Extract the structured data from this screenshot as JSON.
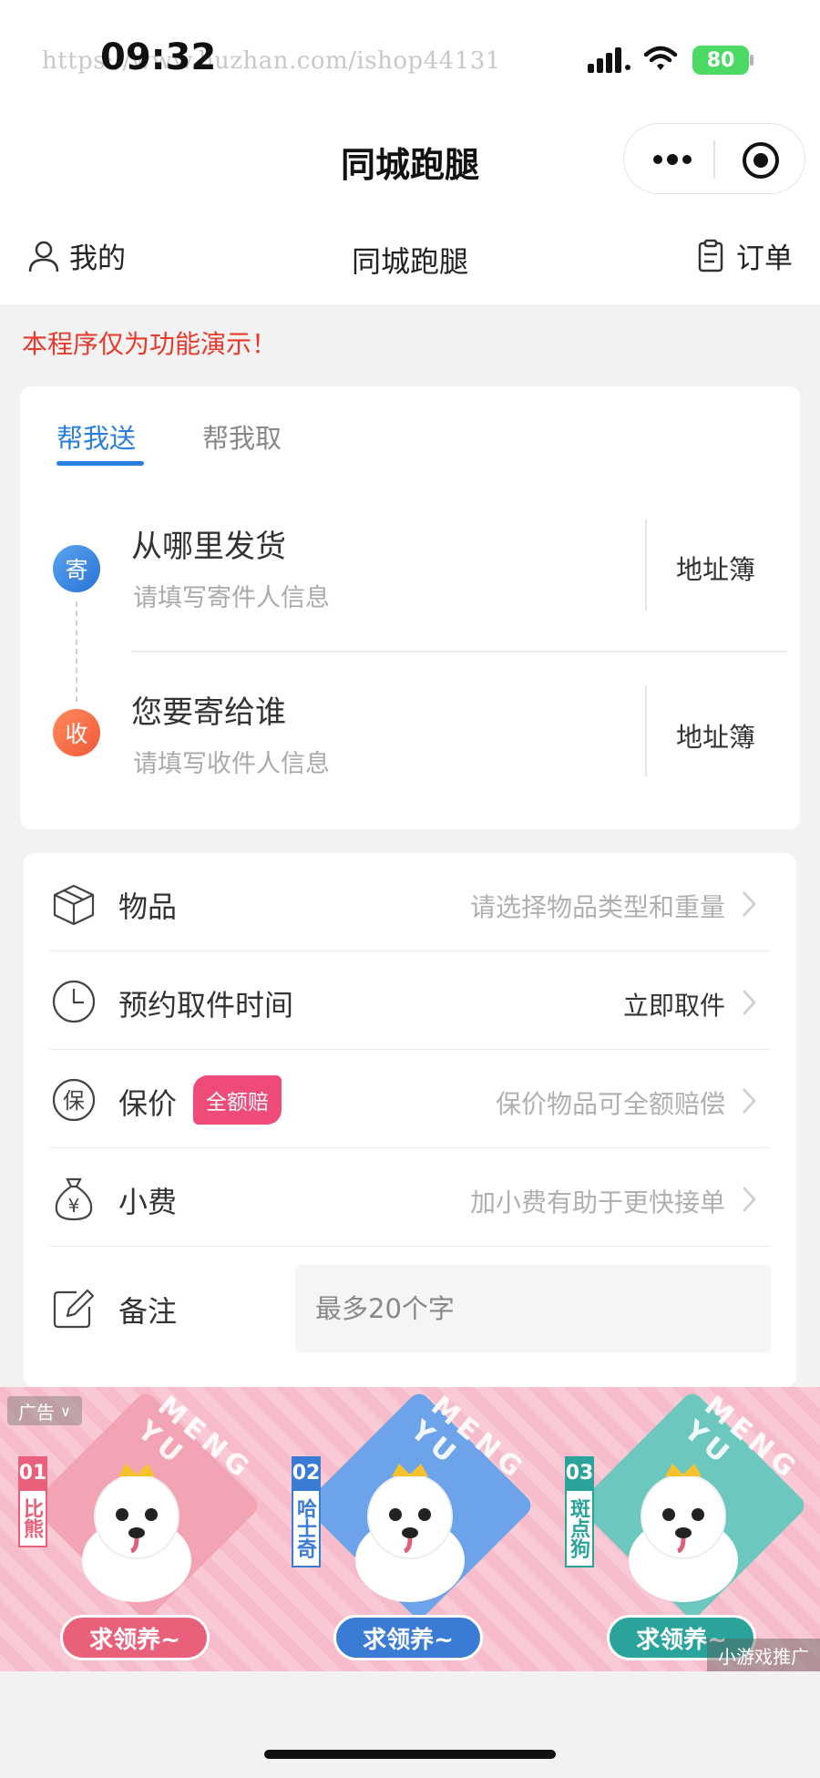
{
  "status_bar": {
    "watermark": "https://www.huzhan.com/ishop44131",
    "time": "09:32",
    "battery": "80"
  },
  "nav": {
    "title": "同城跑腿"
  },
  "header": {
    "my_label": "我的",
    "center_title": "同城跑腿",
    "order_label": "订单"
  },
  "notice": "本程序仅为功能演示！",
  "address_card": {
    "tabs": [
      {
        "label": "帮我送",
        "active": true
      },
      {
        "label": "帮我取",
        "active": false
      }
    ],
    "sender": {
      "badge": "寄",
      "title": "从哪里发货",
      "subtitle": "请填写寄件人信息",
      "book": "地址簿"
    },
    "receiver": {
      "badge": "收",
      "title": "您要寄给谁",
      "subtitle": "请填写收件人信息",
      "book": "地址簿"
    }
  },
  "options": {
    "item": {
      "label": "物品",
      "value": "请选择物品类型和重量",
      "icon": "box-icon"
    },
    "time": {
      "label": "预约取件时间",
      "value": "立即取件",
      "icon": "clock-icon"
    },
    "insurance": {
      "label": "保价",
      "tag": "全额赔",
      "value": "保价物品可全额赔偿",
      "icon": "insurance-icon",
      "icon_char": "保"
    },
    "tip": {
      "label": "小费",
      "value": "加小费有助于更快接单",
      "icon": "money-bag-icon",
      "icon_char": "¥"
    },
    "remark": {
      "label": "备注",
      "placeholder": "最多20个字",
      "icon": "edit-icon"
    }
  },
  "ad": {
    "tag": "广告",
    "promo": "小游戏推广",
    "items": [
      {
        "num": "01",
        "name": "比熊",
        "brand": "MENG YU",
        "cta": "求领养~",
        "color": "#e8607a",
        "diamond": "#f2a4b4"
      },
      {
        "num": "02",
        "name": "哈士奇",
        "brand": "MENG YU",
        "cta": "求领养~",
        "color": "#3a7bd5",
        "diamond": "#6da3e8"
      },
      {
        "num": "03",
        "name": "斑点狗",
        "brand": "MENG YU",
        "cta": "求领养~",
        "color": "#2aa39a",
        "diamond": "#6cc7bf"
      }
    ]
  },
  "colors": {
    "accent": "#2a7ee0",
    "notice": "#e6392b",
    "tag": "#ef4b78",
    "battery": "#4cd964"
  }
}
